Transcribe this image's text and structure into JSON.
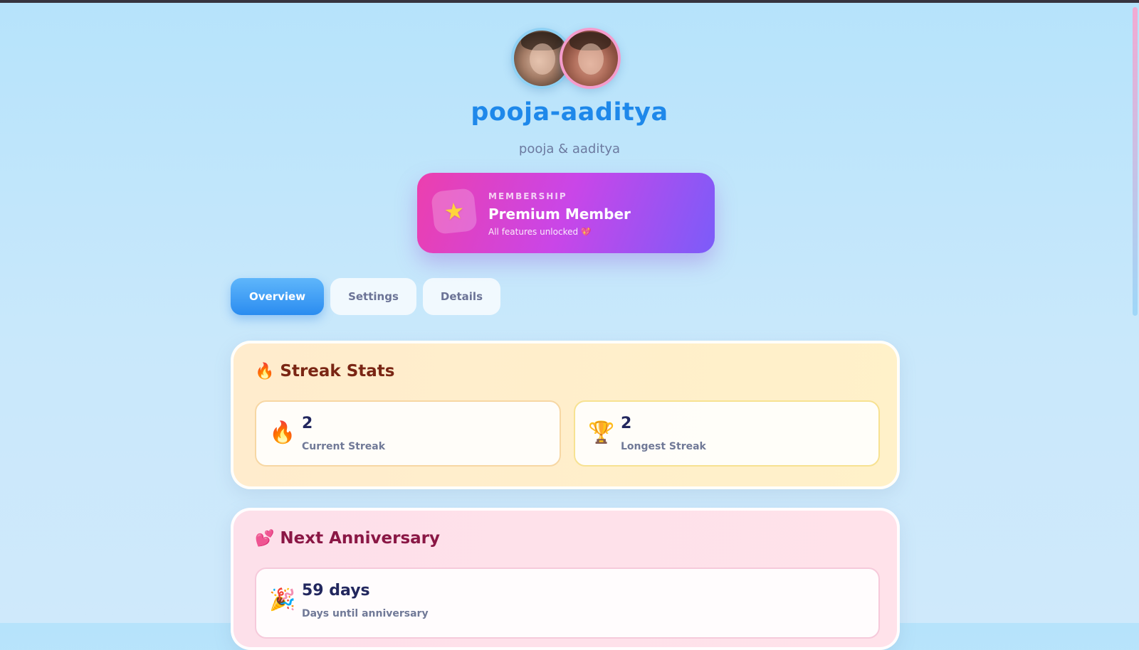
{
  "header": {
    "title": "pooja-aaditya",
    "subtitle": "pooja & aaditya",
    "avatars": [
      "avatar-photo",
      "avatar-photo"
    ]
  },
  "membership": {
    "icon": "star-icon",
    "label": "MEMBERSHIP",
    "title": "Premium Member",
    "note": "All features unlocked 💖"
  },
  "tabs": [
    {
      "label": "Overview",
      "active": true
    },
    {
      "label": "Settings",
      "active": false
    },
    {
      "label": "Details",
      "active": false
    }
  ],
  "streak_stats": {
    "title": "Streak Stats",
    "icon": "fire-icon",
    "cards": [
      {
        "icon": "fire-icon",
        "value": "2",
        "label": "Current Streak"
      },
      {
        "icon": "trophy-icon",
        "value": "2",
        "label": "Longest Streak"
      }
    ]
  },
  "next_anniversary": {
    "title": "Next Anniversary",
    "icon": "hearts-icon",
    "card": {
      "icon": "party-popper-icon",
      "value": "59 days",
      "label": "Days until anniversary"
    }
  },
  "colors": {
    "accent_blue": "#1e88ea",
    "membership_gradient_start": "#ec3fae",
    "membership_gradient_end": "#7b5cf9",
    "streak_panel": "#ffeccd",
    "anniversary_panel": "#fde0ea"
  }
}
